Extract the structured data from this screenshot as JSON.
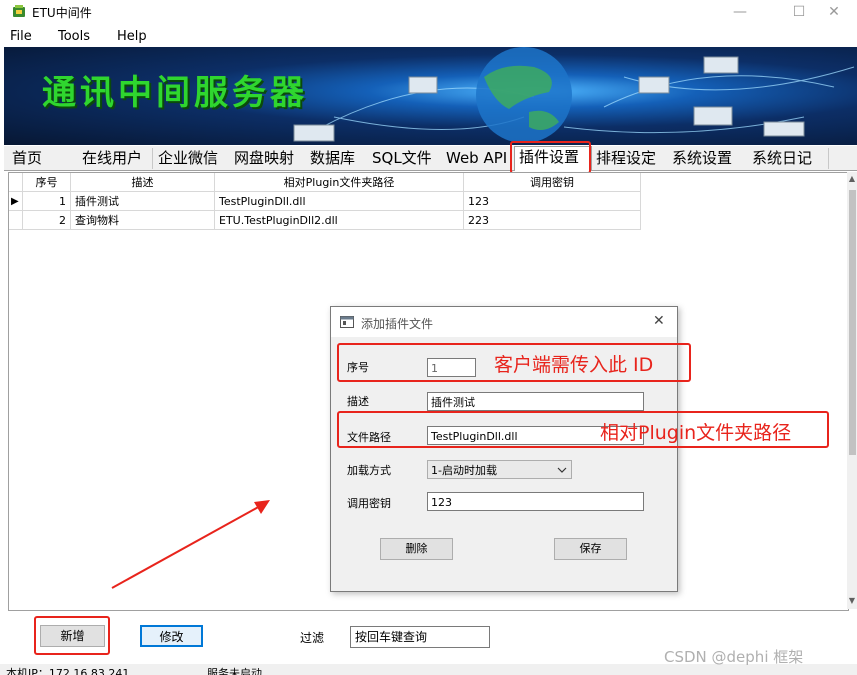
{
  "window": {
    "title": "ETU中间件",
    "minimize": "—",
    "maximize": "☐",
    "close": "✕"
  },
  "menu": [
    "File",
    "Tools",
    "Help"
  ],
  "banner": {
    "title": "通讯中间服务器"
  },
  "tabs": [
    "首页",
    "在线用户",
    "企业微信",
    "网盘映射",
    "数据库",
    "SQL文件",
    "Web API",
    "插件设置",
    "排程设定",
    "系统设置",
    "系统日记"
  ],
  "active_tab_index": 7,
  "grid": {
    "columns": [
      "序号",
      "描述",
      "相对Plugin文件夹路径",
      "调用密钥"
    ],
    "rows": [
      {
        "no": "1",
        "desc": "插件测试",
        "path": "TestPluginDll.dll",
        "key": "123",
        "current": true
      },
      {
        "no": "2",
        "desc": "查询物料",
        "path": "ETU.TestPluginDll2.dll",
        "key": "223",
        "current": false
      }
    ],
    "row_indicator": "▶"
  },
  "dialog": {
    "title": "添加插件文件",
    "close": "✕",
    "fields": {
      "no_label": "序号",
      "no_value": "1",
      "desc_label": "描述",
      "desc_value": "插件测试",
      "path_label": "文件路径",
      "path_value": "TestPluginDll.dll",
      "load_label": "加载方式",
      "load_value": "1-启动时加载",
      "key_label": "调用密钥",
      "key_value": "123"
    },
    "delete_label": "删除",
    "save_label": "保存"
  },
  "annotations": {
    "id_note": "客户端需传入此 ID",
    "path_note": "相对Plugin文件夹路径",
    "color": "#e8241c"
  },
  "bottom": {
    "add_label": "新增",
    "edit_label": "修改",
    "filter_label": "过滤",
    "filter_value": "按回车键查询"
  },
  "status": {
    "left": "本机IP：172.16.83.241",
    "right": "服务未启动"
  },
  "watermark": "CSDN @dephi 框架"
}
